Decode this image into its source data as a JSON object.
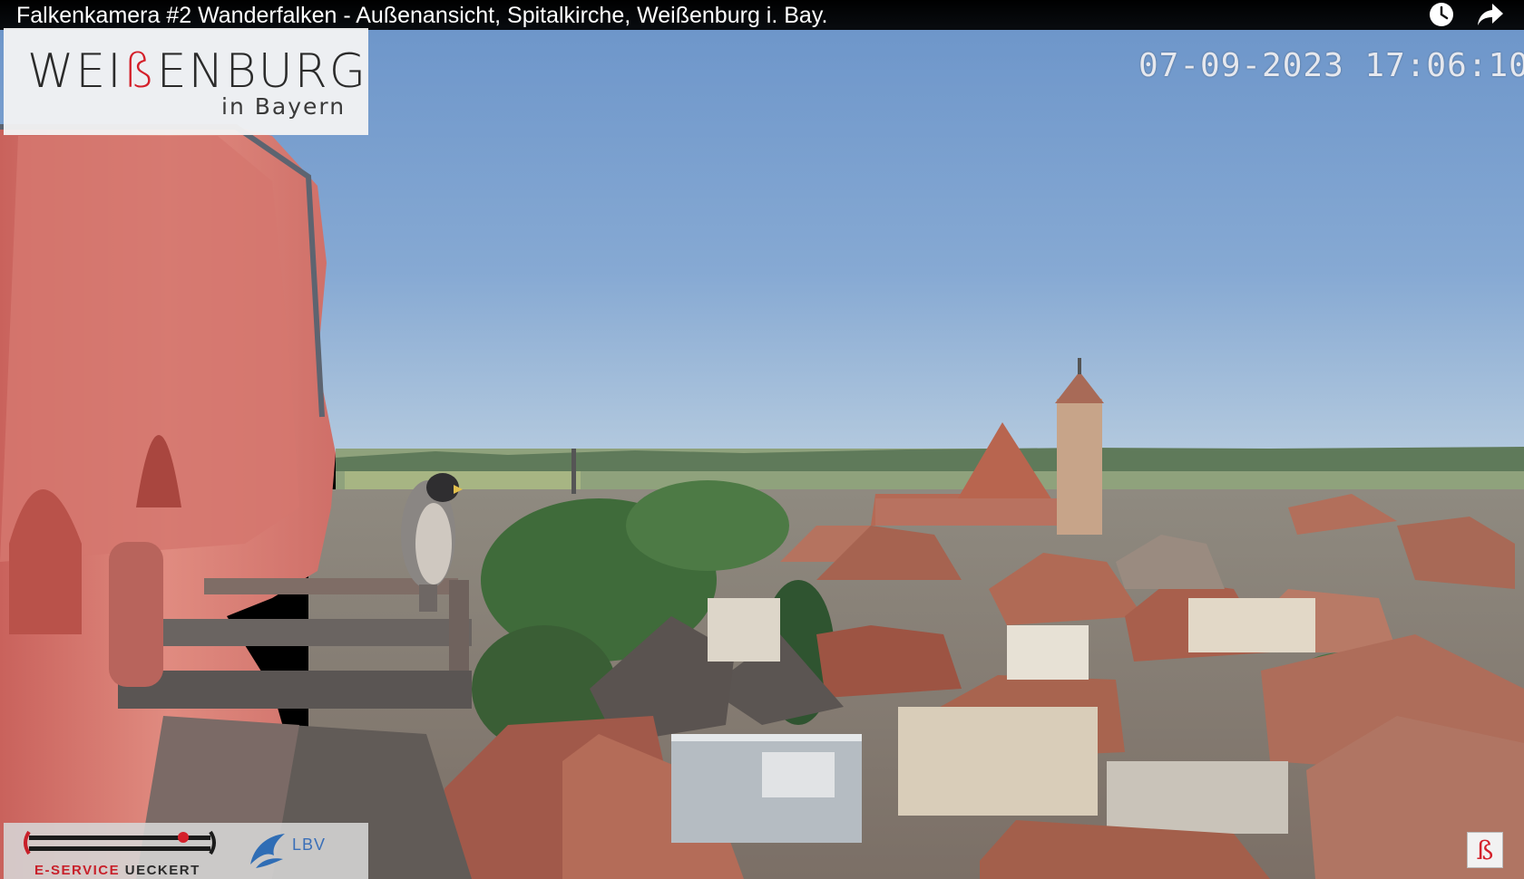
{
  "video": {
    "title": "Falkenkamera #2 Wanderfalken - Außenansicht, Spitalkirche, Weißenburg i. Bay.",
    "timestamp": "07-09-2023 17:06:10"
  },
  "logo": {
    "word_part1": "WEI",
    "word_accent": "ß",
    "word_part2": "ENBURG",
    "subtitle": "in Bayern"
  },
  "sponsor": {
    "eservice_prefix": "E-SERVICE",
    "eservice_name": "UECKERT",
    "lbv": "LBV"
  },
  "corner_badge": {
    "glyph": "ß"
  },
  "controls": {
    "watch_later_icon": "clock-icon",
    "share_icon": "share-arrow-icon"
  },
  "colors": {
    "sky_top": "#6a93c8",
    "sky_horizon": "#a9c3dd",
    "wall_pink": "#d9796f",
    "roof": "#b57662",
    "logo_red": "#d4202a"
  }
}
